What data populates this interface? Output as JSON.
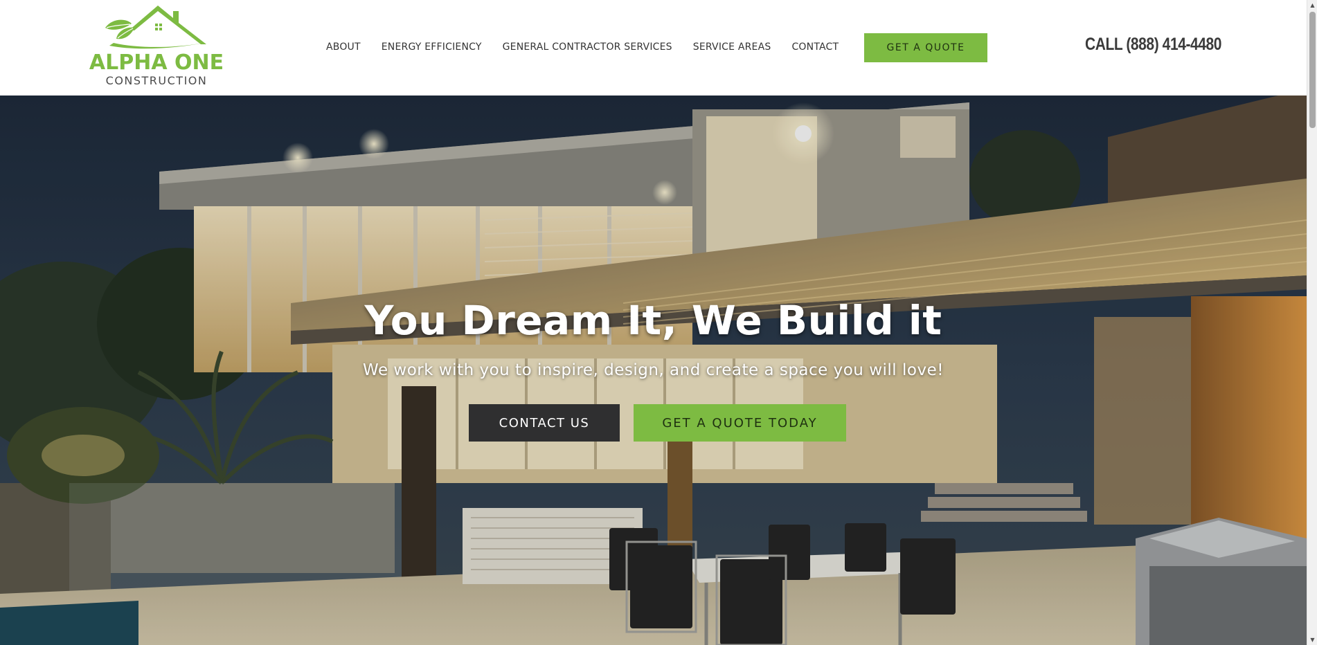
{
  "brand": {
    "name": "ALPHA ONE",
    "tagline": "CONSTRUCTION",
    "green": "#7dbb42",
    "dark": "#2f2f30"
  },
  "nav": {
    "items": [
      {
        "label": "ABOUT"
      },
      {
        "label": "ENERGY EFFICIENCY"
      },
      {
        "label": "GENERAL CONTRACTOR SERVICES"
      },
      {
        "label": "SERVICE AREAS"
      },
      {
        "label": "CONTACT"
      }
    ],
    "quote_button": "GET A QUOTE",
    "phone": "CALL (888) 414-4480"
  },
  "hero": {
    "title": "You Dream It, We Build it",
    "subtitle": "We work with you to inspire, design, and create a space you will love!",
    "contact_button": "CONTACT US",
    "quote_button": "GET A QUOTE TODAY",
    "background": "modern-house-at-dusk-photo"
  },
  "icons": {
    "scroll_up": "scroll-up-arrow-icon",
    "scroll_down": "scroll-down-arrow-icon",
    "logo": "house-with-leaves-logo-icon"
  }
}
